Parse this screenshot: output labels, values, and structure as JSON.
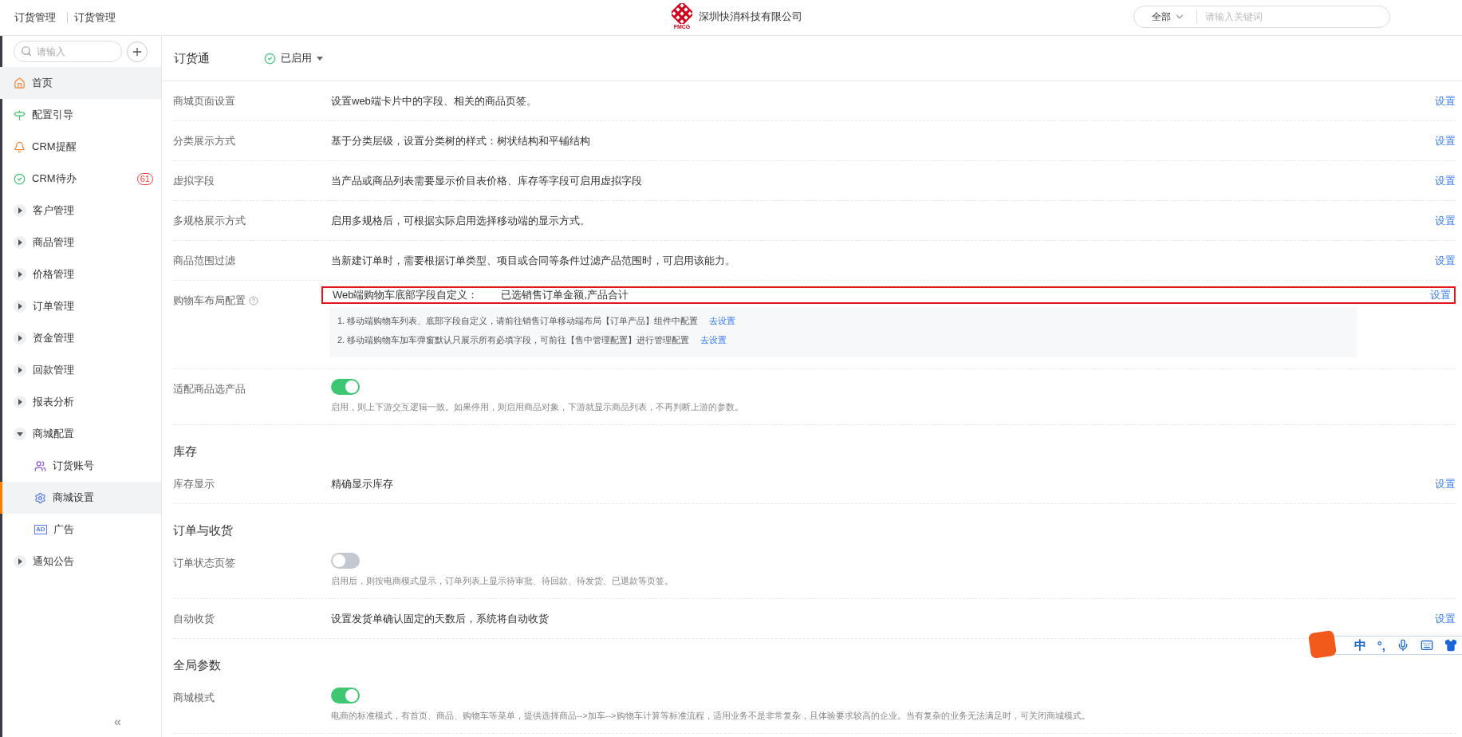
{
  "topbar": {
    "app": "订货管理",
    "breadcrumb": "订货管理",
    "logo_text": "FMCG",
    "company": "深圳快消科技有限公司",
    "search": {
      "scope": "全部",
      "placeholder": "请输入关键词"
    }
  },
  "sidebar": {
    "search_placeholder": "请输入",
    "collapse": "«",
    "items": [
      {
        "label": "首页",
        "kind": "home",
        "hovered": true,
        "selected": false
      },
      {
        "label": "配置引导",
        "kind": "guide",
        "hovered": false,
        "selected": false
      },
      {
        "label": "CRM提醒",
        "kind": "bell",
        "hovered": false,
        "selected": false
      },
      {
        "label": "CRM待办",
        "kind": "check",
        "hovered": false,
        "selected": false,
        "badge": "61"
      },
      {
        "label": "客户管理",
        "kind": "group",
        "expanded": false,
        "hovered": false,
        "selected": false
      },
      {
        "label": "商品管理",
        "kind": "group",
        "expanded": false,
        "hovered": false,
        "selected": false
      },
      {
        "label": "价格管理",
        "kind": "group",
        "expanded": false,
        "hovered": false,
        "selected": false
      },
      {
        "label": "订单管理",
        "kind": "group",
        "expanded": false,
        "hovered": false,
        "selected": false
      },
      {
        "label": "资金管理",
        "kind": "group",
        "expanded": false,
        "hovered": false,
        "selected": false
      },
      {
        "label": "回款管理",
        "kind": "group",
        "expanded": false,
        "hovered": false,
        "selected": false
      },
      {
        "label": "报表分析",
        "kind": "group",
        "expanded": false,
        "hovered": false,
        "selected": false
      },
      {
        "label": "商城配置",
        "kind": "group",
        "expanded": true,
        "hovered": false,
        "selected": false,
        "children": [
          {
            "label": "订货账号",
            "kind": "users",
            "selected": false
          },
          {
            "label": "商城设置",
            "kind": "gear",
            "selected": true
          },
          {
            "label": "广告",
            "kind": "ad",
            "icon_text": "AD",
            "selected": false
          }
        ]
      },
      {
        "label": "通知公告",
        "kind": "group",
        "expanded": false,
        "hovered": false,
        "selected": false
      }
    ]
  },
  "header": {
    "title": "订货通",
    "status": "已启用"
  },
  "sections": [
    {
      "rows": [
        {
          "kind": "text",
          "label": "商城页面设置",
          "description": "设置web端卡片中的字段、相关的商品页签。",
          "action": "设置"
        },
        {
          "kind": "text",
          "label": "分类展示方式",
          "description": "基于分类层级，设置分类树的样式：树状结构和平铺结构",
          "action": "设置"
        },
        {
          "kind": "text",
          "label": "虚拟字段",
          "description": "当产品或商品列表需要显示价目表价格、库存等字段可启用虚拟字段",
          "action": "设置"
        },
        {
          "kind": "text",
          "label": "多规格展示方式",
          "description": "启用多规格后，可根据实际启用选择移动端的显示方式。",
          "action": "设置"
        },
        {
          "kind": "text",
          "label": "商品范围过滤",
          "description": "当新建订单时，需要根据订单类型、项目或合同等条件过滤产品范围时，可启用该能力。",
          "action": "设置"
        },
        {
          "kind": "text",
          "label": "购物车布局配置",
          "help": true,
          "highlighted": true,
          "description": "Web端购物车底部字段自定义：",
          "value": "已选销售订单金额,产品合计",
          "action": "设置",
          "notes": [
            {
              "text": "1. 移动端购物车列表、底部字段自定义，请前往销售订单移动端布局【订单产品】组件中配置",
              "link": "去设置"
            },
            {
              "text": "2. 移动端购物车加车弹窗默认只展示所有必填字段，可前往【售中管理配置】进行管理配置",
              "link": "去设置"
            }
          ]
        },
        {
          "kind": "toggle",
          "label": "适配商品选产品",
          "on": true,
          "description": "启用，则上下游交互逻辑一致。如果停用，则启用商品对象，下游就显示商品列表，不再判断上游的参数。"
        }
      ]
    },
    {
      "title": "库存",
      "rows": [
        {
          "kind": "text",
          "label": "库存显示",
          "description": "精确显示库存",
          "action": "设置"
        }
      ]
    },
    {
      "title": "订单与收货",
      "rows": [
        {
          "kind": "toggle",
          "label": "订单状态页签",
          "on": false,
          "description": "启用后，则按电商模式显示，订单列表上显示待审批、待回款、待发货、已退款等页签。"
        },
        {
          "kind": "text",
          "label": "自动收货",
          "description": "设置发货单确认固定的天数后，系统将自动收货",
          "action": "设置"
        }
      ]
    },
    {
      "title": "全局参数",
      "rows": [
        {
          "kind": "toggle",
          "label": "商城模式",
          "on": true,
          "description": "电商的标准模式，有首页、商品、购物车等菜单，提供选择商品-->加车-->购物车计算等标准流程，适用业务不是非常复杂，且体验要求较高的企业。当有复杂的业务无法满足时，可关闭商城模式。"
        }
      ]
    }
  ],
  "ime": {
    "lang": "中",
    "punct": "°,"
  }
}
